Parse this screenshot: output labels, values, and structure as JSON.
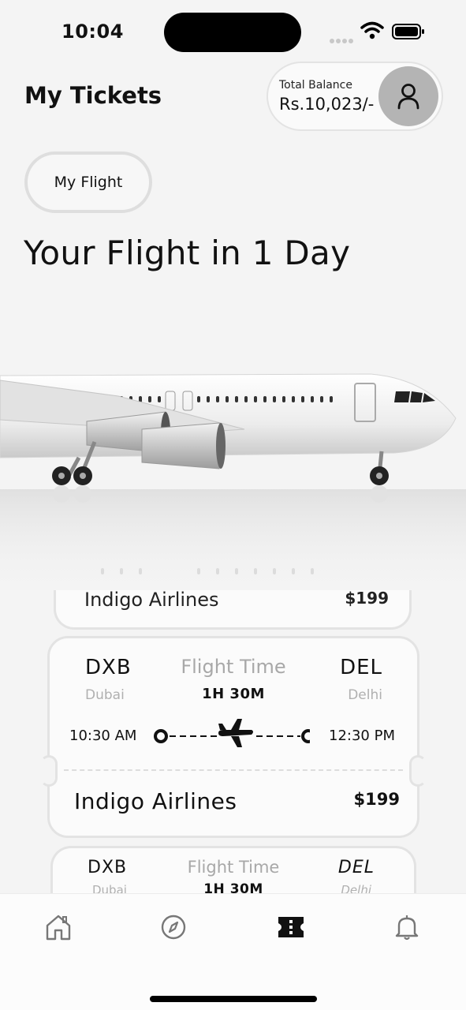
{
  "status_bar": {
    "time": "10:04"
  },
  "header": {
    "title": "My Tickets",
    "balance_label": "Total Balance",
    "balance_value": "Rs.10,023/-",
    "avatar_icon": "user-icon"
  },
  "filter_chip": {
    "label": "My Flight"
  },
  "headline": "Your Flight in 1 Day",
  "tickets": [
    {
      "airline": "Indigo Airlines",
      "price": "$199"
    },
    {
      "from_code": "DXB",
      "from_city": "Dubai",
      "to_code": "DEL",
      "to_city": "Delhi",
      "flight_time_label": "Flight Time",
      "flight_time": "1H 30M",
      "depart": "10:30 AM",
      "arrive": "12:30 PM",
      "airline": "Indigo Airlines",
      "price": "$199"
    },
    {
      "from_code": "DXB",
      "from_city": "Dubai",
      "to_code": "DEL",
      "to_city": "Delhi",
      "flight_time_label": "Flight Time",
      "flight_time": "1H 30M"
    }
  ],
  "nav": {
    "items": [
      {
        "icon": "home-icon"
      },
      {
        "icon": "compass-icon"
      },
      {
        "icon": "ticket-icon",
        "active": true
      },
      {
        "icon": "bell-icon"
      }
    ]
  },
  "colors": {
    "background": "#f4f4f4",
    "accent": "#111111",
    "muted": "#b0b0b0"
  }
}
